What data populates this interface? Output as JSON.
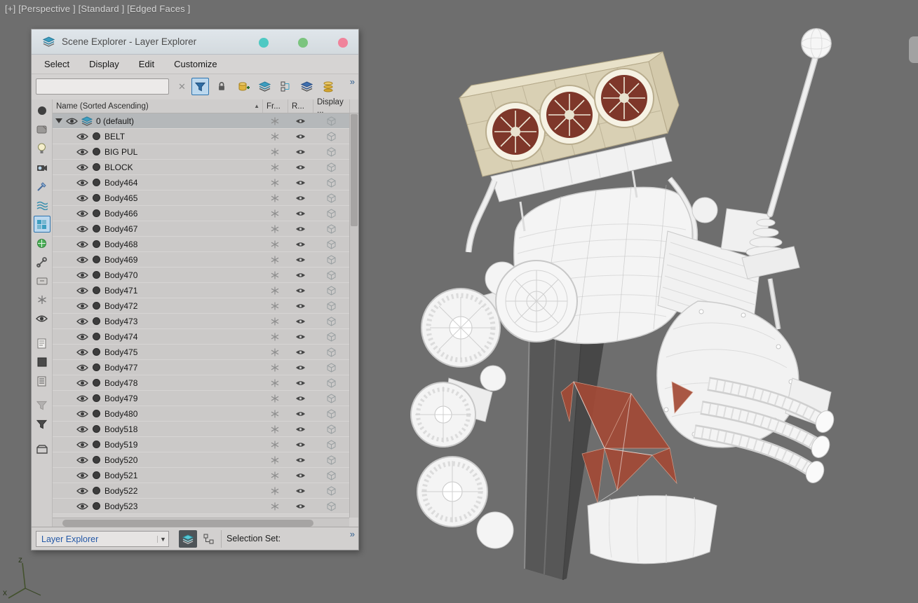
{
  "viewport": {
    "label": "[+] [Perspective ] [Standard ] [Edged Faces ]",
    "axis": {
      "z": "z",
      "x": "x"
    }
  },
  "explorer": {
    "title": "Scene Explorer - Layer Explorer",
    "menu": [
      "Select",
      "Display",
      "Edit",
      "Customize"
    ],
    "search": {
      "value": "",
      "clear": "✕"
    },
    "toolbar_overflow": "»",
    "columns": {
      "name": "Name (Sorted Ascending)",
      "sort_arrow": "▲",
      "frozen": "Fr...",
      "render": "R...",
      "display": "Display ..."
    },
    "root_layer": "0 (default)",
    "layers": [
      "BELT",
      "BIG PUL",
      "BLOCK",
      "Body464",
      "Body465",
      "Body466",
      "Body467",
      "Body468",
      "Body469",
      "Body470",
      "Body471",
      "Body472",
      "Body473",
      "Body474",
      "Body475",
      "Body477",
      "Body478",
      "Body479",
      "Body480",
      "Body518",
      "Body519",
      "Body520",
      "Body521",
      "Body522",
      "Body523"
    ],
    "footer": {
      "mode": "Layer Explorer",
      "dropdown_arrow": "▼",
      "selection_set": "Selection Set:",
      "overflow": "»"
    }
  },
  "icons": {
    "titlebar": [
      "layers-icon"
    ],
    "toolbar": [
      "clear-search-icon",
      "filter-icon",
      "lock-icon",
      "add-layer-icon",
      "layers-stack-icon",
      "collapse-tree-icon",
      "layers-stack-icon",
      "cylinders-icon",
      "overflow-chevrons"
    ],
    "left_strip": [
      "display-objects-icon",
      "display-shapes-icon",
      "display-lights-icon",
      "display-cameras-icon",
      "display-splines-icon",
      "display-spacewarps-icon",
      "layer-mode-icon",
      "display-helpers-icon",
      "display-bones-icon",
      "display-containers-icon",
      "frozen-filter-icon",
      "hidden-filter-icon",
      "properties-icon",
      "color-swatch-icon",
      "notes-icon",
      "filter-disabled-icon",
      "filter-active-icon",
      "bin-icon"
    ],
    "row": [
      "visibility-eye-icon",
      "layer-color-icon",
      "freeze-snowflake-icon",
      "render-eye-icon",
      "display-cube-icon"
    ]
  },
  "colors": {
    "viewport_bg": "#6e6e6e",
    "filter_highlight": "#2e74ae",
    "combo_text": "#2458a6",
    "scoop_tan": "#d9d0b4",
    "engine_red": "#a34a36",
    "belt_gray": "#575757",
    "titlebar_dots": [
      "#4ec9c3",
      "#7bc47e",
      "#f0839b"
    ]
  }
}
